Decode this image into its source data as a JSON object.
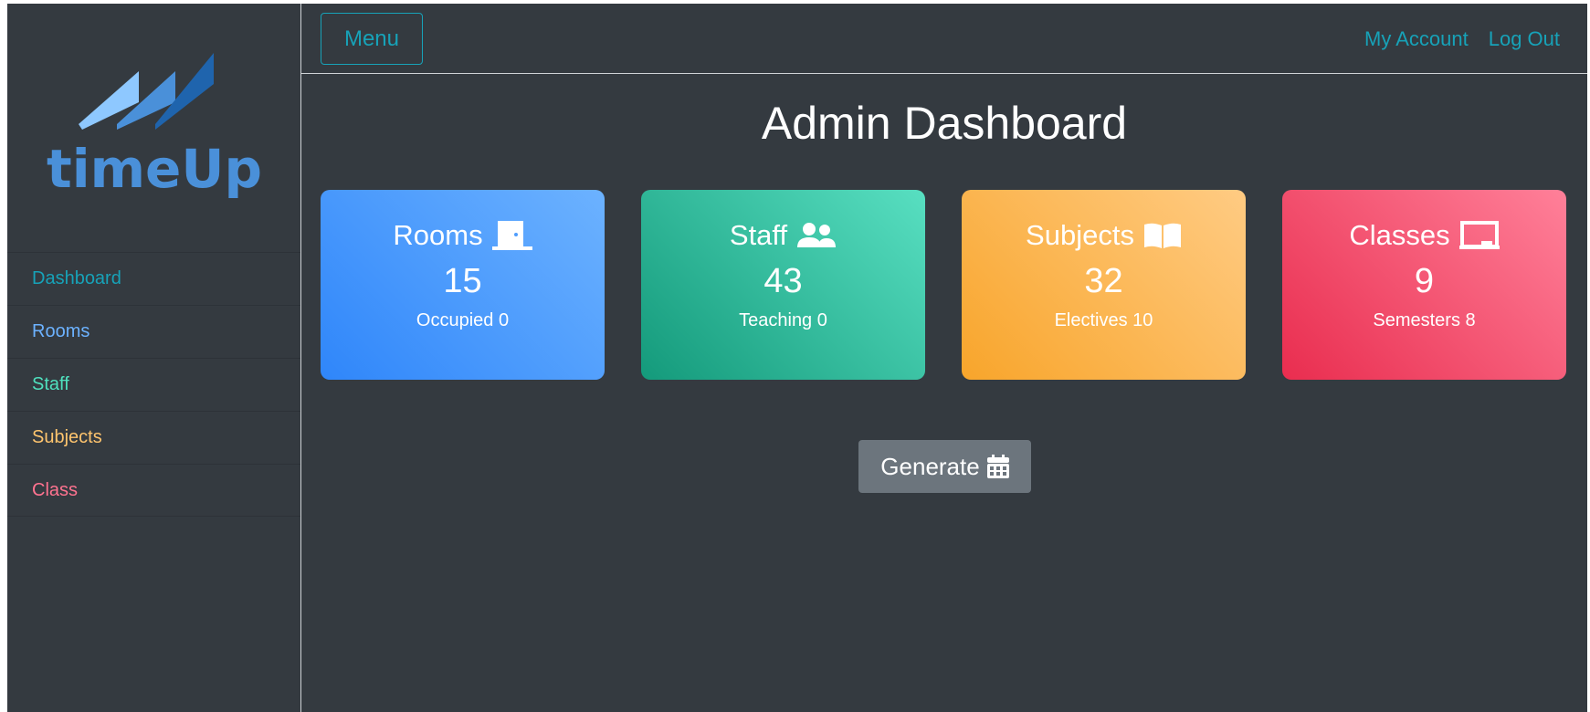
{
  "brand": {
    "name": "timeUp",
    "color": "#4a90d9",
    "mark_colors": [
      "#8ec8ff",
      "#4a90d9",
      "#1f64ad"
    ]
  },
  "sidebar": {
    "items": [
      {
        "label": "Dashboard",
        "color": "#17a2b8"
      },
      {
        "label": "Rooms",
        "color": "#6cb2ff"
      },
      {
        "label": "Staff",
        "color": "#4fe0be"
      },
      {
        "label": "Subjects",
        "color": "#ffc56e"
      },
      {
        "label": "Class",
        "color": "#ff7390"
      }
    ]
  },
  "header": {
    "menu_label": "Menu",
    "links": [
      "My Account",
      "Log Out"
    ],
    "accent": "#17a2b8"
  },
  "main": {
    "title": "Admin Dashboard",
    "cards": [
      {
        "title": "Rooms",
        "icon": "door-icon",
        "value": "15",
        "sub": "Occupied 0"
      },
      {
        "title": "Staff",
        "icon": "users-icon",
        "value": "43",
        "sub": "Teaching 0"
      },
      {
        "title": "Subjects",
        "icon": "book-icon",
        "value": "32",
        "sub": "Electives 10"
      },
      {
        "title": "Classes",
        "icon": "chalkboard-icon",
        "value": "9",
        "sub": "Semesters 8"
      }
    ],
    "generate_label": "Generate",
    "generate_icon": "calendar-icon"
  }
}
